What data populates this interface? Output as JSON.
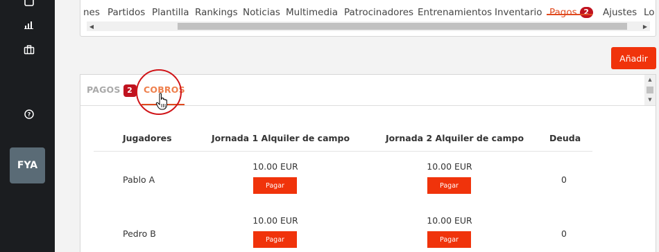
{
  "sidebar": {
    "icons": [
      "document-icon",
      "bar-chart-icon",
      "briefcase-icon",
      "help-icon"
    ],
    "team_badge": "FYA"
  },
  "top_tabs": {
    "items": [
      {
        "label": "nes"
      },
      {
        "label": "Partidos"
      },
      {
        "label": "Plantilla"
      },
      {
        "label": "Rankings"
      },
      {
        "label": "Noticias"
      },
      {
        "label": "Multimedia"
      },
      {
        "label": "Patrocinadores"
      },
      {
        "label": "Entrenamientos"
      },
      {
        "label": "Inventario"
      },
      {
        "label": "Pagos",
        "badge": "2",
        "active": true
      },
      {
        "label": "Ajustes"
      },
      {
        "label": "Lo"
      }
    ]
  },
  "add_button": "Añadir",
  "subtabs": {
    "pagos": {
      "label": "PAGOS",
      "badge": "2"
    },
    "cobros": {
      "label": "COBROS",
      "active": true
    }
  },
  "table": {
    "headers": [
      "Jugadores",
      "Jornada 1 Alquiler de campo",
      "Jornada 2 Alquiler de campo",
      "Deuda"
    ],
    "rows": [
      {
        "player": "Pablo A",
        "j1_amount": "10.00 EUR",
        "j1_button": "Pagar",
        "j2_amount": "10.00 EUR",
        "j2_button": "Pagar",
        "debt": "0"
      },
      {
        "player": "Pedro B",
        "j1_amount": "10.00 EUR",
        "j1_button": "Pagar",
        "j2_amount": "10.00 EUR",
        "j2_button": "Pagar",
        "debt": "0"
      }
    ]
  },
  "colors": {
    "accent": "#f0330b",
    "active_tab": "#e04a1f",
    "badge": "#c0131f",
    "sidebar": "#1b1d20",
    "team_badge_bg": "#5a6b76"
  }
}
